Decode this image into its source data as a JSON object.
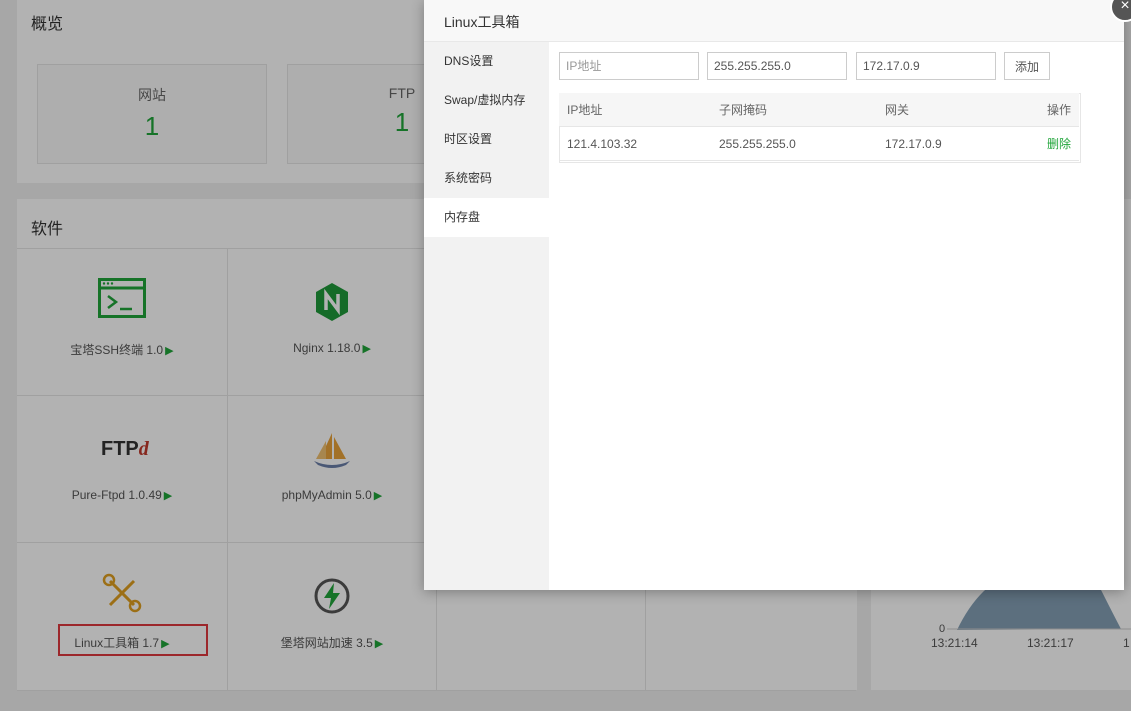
{
  "overview": {
    "title": "概览",
    "stats": [
      {
        "label": "网站",
        "value": "1"
      },
      {
        "label": "FTP",
        "value": "1"
      }
    ]
  },
  "software": {
    "title": "软件",
    "items": [
      {
        "label": "宝塔SSH终端 1.0",
        "icon": "terminal-icon"
      },
      {
        "label": "Nginx 1.18.0",
        "icon": "nginx-icon"
      },
      {
        "label": "Pure-Ftpd 1.0.49",
        "icon": "ftp-icon"
      },
      {
        "label": "phpMyAdmin 5.0",
        "icon": "phpmyadmin-icon"
      },
      {
        "label": "Linux工具箱 1.7",
        "icon": "tools-icon"
      },
      {
        "label": "堡塔网站加速 3.5",
        "icon": "bolt-icon"
      }
    ]
  },
  "chart": {
    "y_ticks": [
      "0"
    ],
    "x_ticks": [
      "13:21:14",
      "13:21:17",
      "1"
    ]
  },
  "modal": {
    "title": "Linux工具箱",
    "sidebar": [
      {
        "label": "DNS设置"
      },
      {
        "label": "Swap/虚拟内存"
      },
      {
        "label": "时区设置"
      },
      {
        "label": "系统密码"
      },
      {
        "label": "内存盘"
      }
    ],
    "form": {
      "ip_placeholder": "IP地址",
      "mask_value": "255.255.255.0",
      "gateway_value": "172.17.0.9",
      "add_label": "添加"
    },
    "table": {
      "headers": [
        "IP地址",
        "子网掩码",
        "网关",
        "操作"
      ],
      "rows": [
        {
          "ip": "121.4.103.32",
          "mask": "255.255.255.0",
          "gateway": "172.17.0.9",
          "action": "删除"
        }
      ]
    }
  },
  "colors": {
    "accent": "#20a53a",
    "highlight_box": "#e0393e"
  }
}
